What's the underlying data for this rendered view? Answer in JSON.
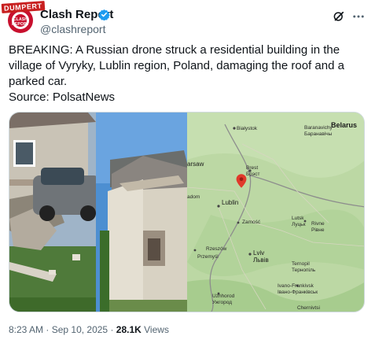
{
  "watermark": "DUMPERT",
  "author": {
    "avatar_text": "CLASH REPORT",
    "name": "Clash Report",
    "handle": "@clashreport"
  },
  "tweet": {
    "text": "BREAKING: A Russian drone struck a residential building in the village of Vyryky, Lublin region, Poland, damaging the roof and a parked car.",
    "source": "Source: PolsatNews"
  },
  "map": {
    "labels": {
      "bialystok": "Białystok",
      "belarus": "Belarus",
      "baranavichy": "Baranavichy",
      "baranavichy_cyr": "Баранавічы",
      "warsaw": "arsaw",
      "radom": "adom",
      "brest": "Brest",
      "brest_cyr": "Брэст",
      "lublin": "Lublin",
      "zamosc": "Zamość",
      "lutsk": "Lutsk",
      "lutsk_cyr": "Луцьк",
      "rivne": "Rivne",
      "rivne_cyr": "Рівне",
      "rzeszow": "Rzeszów",
      "przemysl": "Przemyśl",
      "lviv": "Lviv",
      "lviv_cyr": "Львів",
      "ternopil": "Ternopil",
      "ternopil_cyr": "Тернопіль",
      "ivano": "Ivano-Frankivsk",
      "ivano_cyr": "Івано-Франківськ",
      "uzhhorod": "Uzhhorod",
      "uzhhorod_cyr": "Ужгород",
      "chernivtsi": "Chernivtsi"
    }
  },
  "meta": {
    "time": "8:23 AM",
    "separator": " · ",
    "date": "Sep 10, 2025",
    "views_count": "28.1K",
    "views_label": " Views"
  },
  "colors": {
    "verified": "#1d9bf0",
    "brand_red": "#c8102e",
    "map_land": "#b9d6a2",
    "text_secondary": "#536471"
  },
  "icons": [
    "verified-badge-icon",
    "grok-icon",
    "more-options-icon",
    "map-pin-icon"
  ]
}
